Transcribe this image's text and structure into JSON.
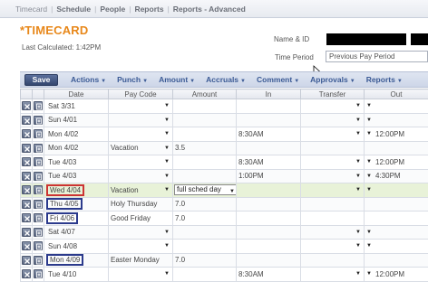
{
  "nav": {
    "items": [
      "Timecard",
      "Schedule",
      "People",
      "Reports",
      "Reports - Advanced"
    ]
  },
  "header": {
    "title": "*TIMECARD",
    "last_calculated": "Last Calculated: 1:42PM",
    "name_id_label": "Name & ID",
    "time_period_label": "Time Period",
    "time_period_value": "Previous Pay Period"
  },
  "toolbar": {
    "save_label": "Save",
    "menus": [
      "Actions",
      "Punch",
      "Amount",
      "Accruals",
      "Comment",
      "Approvals",
      "Reports"
    ]
  },
  "columns": [
    "Date",
    "Pay Code",
    "Amount",
    "In",
    "Transfer",
    "Out"
  ],
  "rows": [
    {
      "date": "Sat 3/31",
      "pay_code": "",
      "amount": "",
      "in": "",
      "transfer": "",
      "out": ""
    },
    {
      "date": "Sun 4/01",
      "pay_code": "",
      "amount": "",
      "in": "",
      "transfer": "",
      "out": ""
    },
    {
      "date": "Mon 4/02",
      "pay_code": "",
      "amount": "",
      "in": "8:30AM",
      "transfer": "",
      "out": "12:00PM"
    },
    {
      "date": "Mon 4/02",
      "pay_code": "Vacation",
      "amount": "3.5",
      "in": "",
      "transfer": "",
      "out": ""
    },
    {
      "date": "Tue 4/03",
      "pay_code": "",
      "amount": "",
      "in": "8:30AM",
      "transfer": "",
      "out": "12:00PM"
    },
    {
      "date": "Tue 4/03",
      "pay_code": "",
      "amount": "",
      "in": "1:00PM",
      "transfer": "",
      "out": "4:30PM"
    },
    {
      "date": "Wed 4/04",
      "pay_code": "Vacation",
      "amount": "full sched day",
      "in": "",
      "transfer": "",
      "out": ""
    },
    {
      "date": "Thu 4/05",
      "pay_code": "Holy Thursday",
      "amount": "7.0",
      "in": "",
      "transfer": "",
      "out": ""
    },
    {
      "date": "Fri 4/06",
      "pay_code": "Good Friday",
      "amount": "7.0",
      "in": "",
      "transfer": "",
      "out": ""
    },
    {
      "date": "Sat 4/07",
      "pay_code": "",
      "amount": "",
      "in": "",
      "transfer": "",
      "out": ""
    },
    {
      "date": "Sun 4/08",
      "pay_code": "",
      "amount": "",
      "in": "",
      "transfer": "",
      "out": ""
    },
    {
      "date": "Mon 4/09",
      "pay_code": "Easter Monday",
      "amount": "7.0",
      "in": "",
      "transfer": "",
      "out": ""
    },
    {
      "date": "Tue 4/10",
      "pay_code": "",
      "amount": "",
      "in": "8:30AM",
      "transfer": "",
      "out": "12:00PM"
    }
  ],
  "colors": {
    "title_orange": "#e8881b",
    "pay_code_purple": "#7a2f8e",
    "selected_row_green": "#e8f2d8",
    "highlight_red": "#cc3333",
    "highlight_blue": "#2b3a8c"
  }
}
